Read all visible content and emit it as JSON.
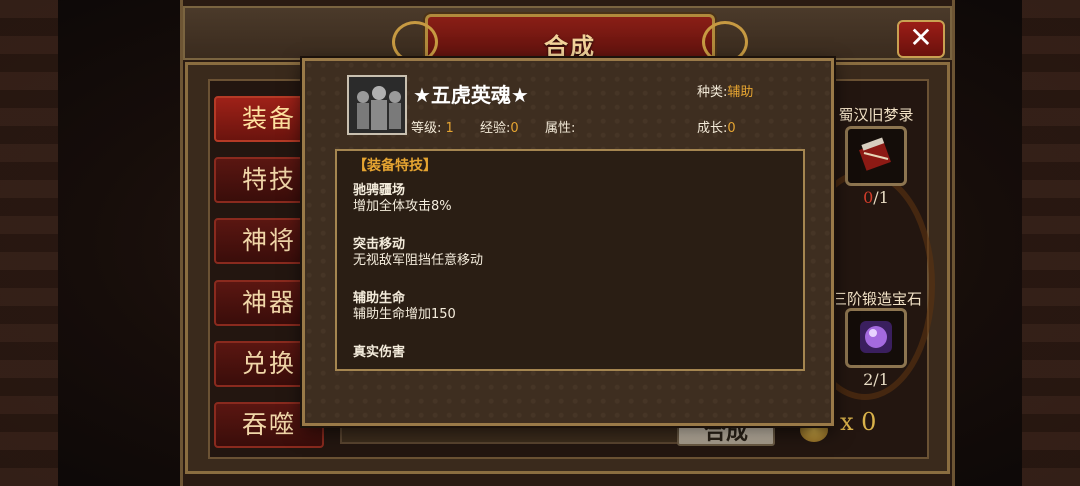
{
  "window": {
    "title": "合成"
  },
  "tabs": [
    {
      "label": "装备",
      "active": true
    },
    {
      "label": "特技",
      "active": false
    },
    {
      "label": "神将",
      "active": false
    },
    {
      "label": "神器",
      "active": false
    },
    {
      "label": "兑换",
      "active": false
    },
    {
      "label": "吞噬",
      "active": false
    }
  ],
  "materials": [
    {
      "name": "蜀汉旧梦录",
      "owned": "0",
      "sep": "/",
      "required": "1",
      "icon": "book-scroll-icon"
    },
    {
      "name": "三阶锻造宝石",
      "owned": "2",
      "sep": "/",
      "required": "1",
      "icon": "purple-gem-icon"
    }
  ],
  "combine": {
    "label": "合成",
    "coin_count": "x 0"
  },
  "popup": {
    "hero_name": "★五虎英魂★",
    "type_label": "种类:",
    "type_value": "辅助",
    "level_label": "等级:",
    "level_value": "1",
    "exp_label": "经验:",
    "exp_value": "0",
    "attr_label": "属性:",
    "growth_label": "成长:",
    "growth_value": "0",
    "section_title": "【装备特技】",
    "skills": [
      {
        "name": "驰骋疆场",
        "desc": "增加全体攻击8%"
      },
      {
        "name": "突击移动",
        "desc": "无视敌军阻挡任意移动"
      },
      {
        "name": "辅助生命",
        "desc": "辅助生命增加150"
      },
      {
        "name": "真实伤害",
        "desc": ""
      }
    ]
  },
  "colors": {
    "accent_gold": "#e5a431",
    "tab_red": "#9e2118",
    "frame_gold": "#9a7a48"
  }
}
